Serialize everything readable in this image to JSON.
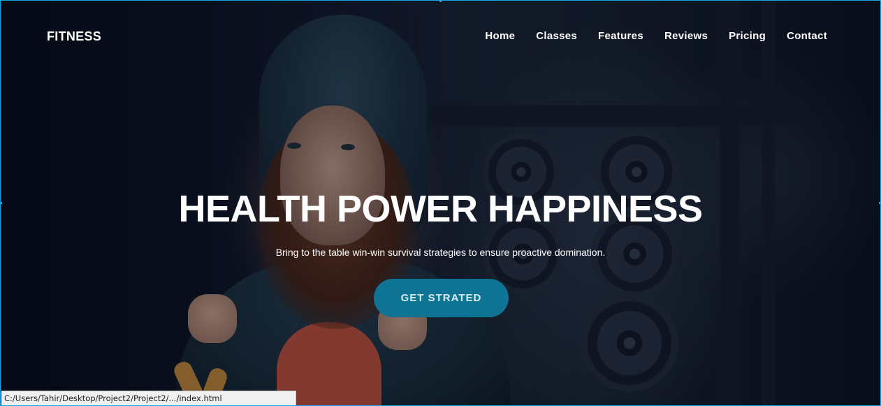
{
  "header": {
    "logo": "FITNESS",
    "nav": [
      {
        "label": "Home"
      },
      {
        "label": "Classes"
      },
      {
        "label": "Features"
      },
      {
        "label": "Reviews"
      },
      {
        "label": "Pricing"
      },
      {
        "label": "Contact"
      }
    ]
  },
  "hero": {
    "title": "HEALTH POWER HAPPINESS",
    "subtitle": "Bring to the table win-win survival strategies to ensure proactive domination.",
    "cta_label": "GET STRATED"
  },
  "status_bar": {
    "url": "C:/Users/Tahir/Desktop/Project2/Project2/.../index.html"
  },
  "colors": {
    "accent": "#0f7393",
    "text": "#ffffff",
    "selection_border": "#1aa3e8"
  }
}
